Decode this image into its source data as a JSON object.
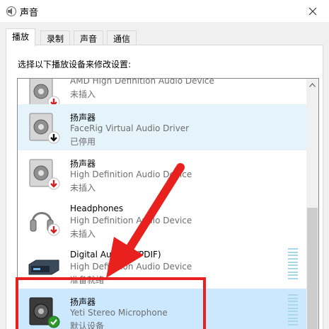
{
  "window": {
    "title": "声音"
  },
  "tabs": [
    {
      "label": "播放",
      "active": true
    },
    {
      "label": "录制",
      "active": false
    },
    {
      "label": "声音",
      "active": false
    },
    {
      "label": "通信",
      "active": false
    }
  ],
  "instruction": "选择以下播放设备来修改设置:",
  "devices": [
    {
      "name": "AMD High Definition Audio Device",
      "description": "",
      "status": "未插入",
      "icon": "speaker-icon",
      "badge": "red-down-arrow-icon"
    },
    {
      "name": "扬声器",
      "description": "FaceRig Virtual Audio Driver",
      "status": "已停用",
      "icon": "speaker-icon",
      "badge": "black-down-arrow-icon"
    },
    {
      "name": "扬声器",
      "description": "High Definition Audio Device",
      "status": "未插入",
      "icon": "speaker-icon",
      "badge": "red-down-arrow-icon"
    },
    {
      "name": "Headphones",
      "description": "High Definition Audio Device",
      "status": "未插入",
      "icon": "headphones-icon",
      "badge": "red-down-arrow-icon"
    },
    {
      "name": "Digital Audio (S/PDIF)",
      "description": "High Definition Audio Device",
      "status": "准备就绪",
      "icon": "digital-audio-icon",
      "badge": ""
    },
    {
      "name": "扬声器",
      "description": "Yeti Stereo Microphone",
      "status": "默认设备",
      "icon": "speaker-icon",
      "badge": "green-check-icon"
    }
  ],
  "colors": {
    "selection_light": "#e5f3fb",
    "selection_dark": "#cce8ff",
    "annotation": "#e8201e",
    "status_green": "#2d9a2d",
    "status_red": "#d21f1f"
  }
}
